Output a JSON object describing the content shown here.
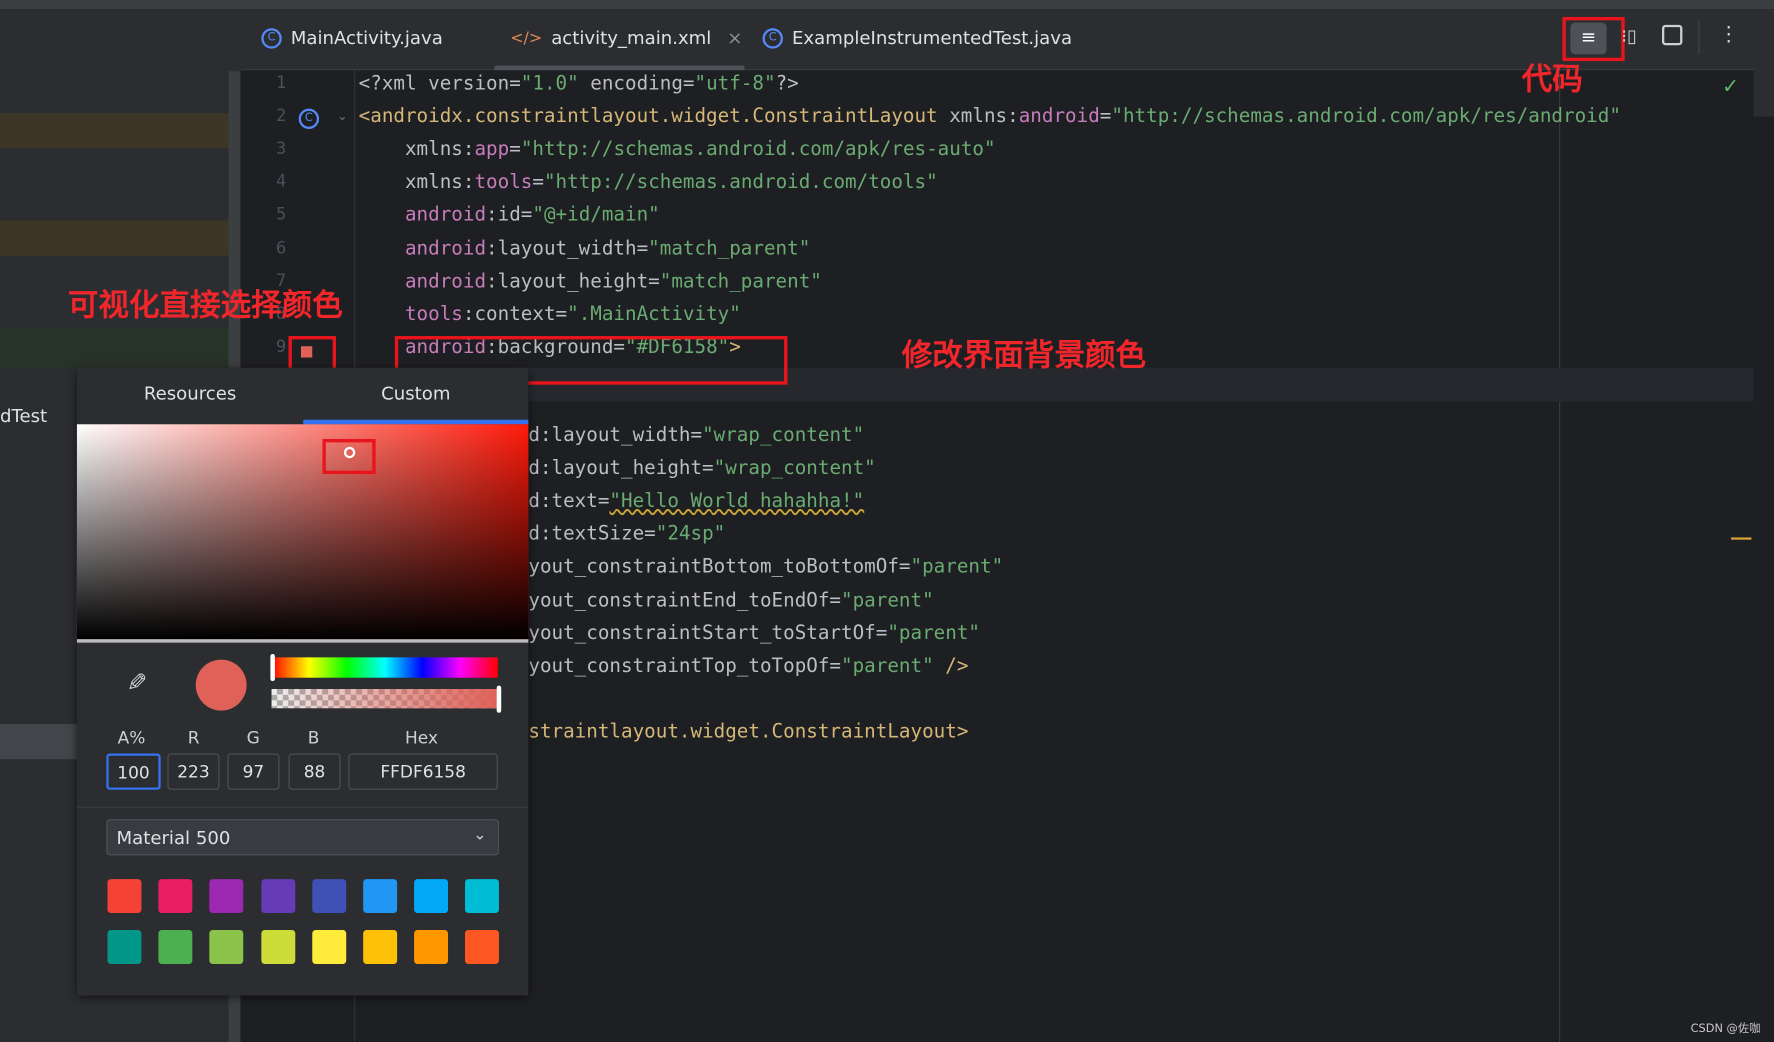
{
  "project_panel": {
    "visible_item": "dTest"
  },
  "tabs": [
    {
      "label": "MainActivity.java",
      "icon": "class-icon"
    },
    {
      "label": "activity_main.xml",
      "icon": "xml-icon",
      "active": true,
      "close": "×"
    },
    {
      "label": "ExampleInstrumentedTest.java",
      "icon": "class-icon"
    }
  ],
  "editor": {
    "lines": [
      {
        "n": "1",
        "seg": [
          [
            "plain",
            "<?xml version="
          ],
          [
            "val",
            "\"1.0\""
          ],
          [
            "plain",
            " encoding="
          ],
          [
            "val",
            "\"utf-8\""
          ],
          [
            "plain",
            "?>"
          ]
        ]
      },
      {
        "n": "2",
        "seg": [
          [
            "tag",
            "<androidx.constraintlayout.widget.ConstraintLayout"
          ],
          [
            "attr",
            " xmlns:"
          ],
          [
            "ns",
            "android"
          ],
          [
            "attr",
            "="
          ],
          [
            "val",
            "\"http://schemas.android.com/apk/res/android\""
          ]
        ]
      },
      {
        "n": "3",
        "seg": [
          [
            "attr",
            "    xmlns:"
          ],
          [
            "ns",
            "app"
          ],
          [
            "attr",
            "="
          ],
          [
            "val",
            "\"http://schemas.android.com/apk/res-auto\""
          ]
        ]
      },
      {
        "n": "4",
        "seg": [
          [
            "attr",
            "    xmlns:"
          ],
          [
            "ns",
            "tools"
          ],
          [
            "attr",
            "="
          ],
          [
            "val",
            "\"http://schemas.android.com/tools\""
          ]
        ]
      },
      {
        "n": "5",
        "seg": [
          [
            "ns",
            "    android"
          ],
          [
            "attr",
            ":id="
          ],
          [
            "val",
            "\"@+id/main\""
          ]
        ]
      },
      {
        "n": "6",
        "seg": [
          [
            "ns",
            "    android"
          ],
          [
            "attr",
            ":layout_width="
          ],
          [
            "val",
            "\"match_parent\""
          ]
        ]
      },
      {
        "n": "7",
        "seg": [
          [
            "ns",
            "    android"
          ],
          [
            "attr",
            ":layout_height="
          ],
          [
            "val",
            "\"match_parent\""
          ]
        ]
      },
      {
        "n": "8",
        "seg": [
          [
            "ns",
            "    tools"
          ],
          [
            "attr",
            ":context="
          ],
          [
            "val",
            "\".MainActivity\""
          ]
        ]
      },
      {
        "n": "9",
        "seg": [
          [
            "ns",
            "    android"
          ],
          [
            "attr",
            ":background="
          ],
          [
            "val",
            "\"#DF6158\""
          ],
          [
            "tag",
            ">"
          ]
        ]
      }
    ],
    "partial_lines": [
      {
        "row": 11,
        "seg": [
          [
            "attr",
            "d:layout_width="
          ],
          [
            "val",
            "\"wrap_content\""
          ]
        ]
      },
      {
        "row": 12,
        "seg": [
          [
            "attr",
            "d:layout_height="
          ],
          [
            "val",
            "\"wrap_content\""
          ]
        ]
      },
      {
        "row": 13,
        "seg": [
          [
            "attr",
            "d:text="
          ],
          [
            "val",
            "\"Hello World hahahha!\""
          ]
        ]
      },
      {
        "row": 14,
        "seg": [
          [
            "attr",
            "d:textSize="
          ],
          [
            "val",
            "\"24sp\""
          ]
        ]
      },
      {
        "row": 15,
        "seg": [
          [
            "attr",
            "yout_constraintBottom_toBottomOf="
          ],
          [
            "val",
            "\"parent\""
          ]
        ]
      },
      {
        "row": 16,
        "seg": [
          [
            "attr",
            "yout_constraintEnd_toEndOf="
          ],
          [
            "val",
            "\"parent\""
          ]
        ]
      },
      {
        "row": 17,
        "seg": [
          [
            "attr",
            "yout_constraintStart_toStartOf="
          ],
          [
            "val",
            "\"parent\""
          ]
        ]
      },
      {
        "row": 18,
        "seg": [
          [
            "attr",
            "yout_constraintTop_toTopOf="
          ],
          [
            "val",
            "\"parent\""
          ],
          [
            "tag",
            " />"
          ]
        ]
      },
      {
        "row": 20,
        "seg": [
          [
            "tag",
            "straintlayout.widget.ConstraintLayout>"
          ]
        ]
      }
    ]
  },
  "annotations": {
    "code": "代码",
    "visual_pick": "可视化直接选择颜色",
    "modify_bg": "修改界面背景颜色"
  },
  "color_picker": {
    "tabs": [
      "Resources",
      "Custom"
    ],
    "active_tab": "Custom",
    "current_color": "#DF6158",
    "labels": {
      "alpha": "A%",
      "r": "R",
      "g": "G",
      "b": "B",
      "hex": "Hex"
    },
    "values": {
      "alpha": "100",
      "r": "223",
      "g": "97",
      "b": "88",
      "hex": "FFDF6158"
    },
    "palette_select": "Material 500",
    "swatches": [
      "#f44336",
      "#e91e63",
      "#9c27b0",
      "#673ab7",
      "#3f51b5",
      "#2196f3",
      "#03a9f4",
      "#00bcd4",
      "#009688",
      "#4caf50",
      "#8bc34a",
      "#cddc39",
      "#ffeb3b",
      "#ffc107",
      "#ff9800",
      "#ff5722"
    ]
  },
  "watermark": "CSDN @佐咖"
}
